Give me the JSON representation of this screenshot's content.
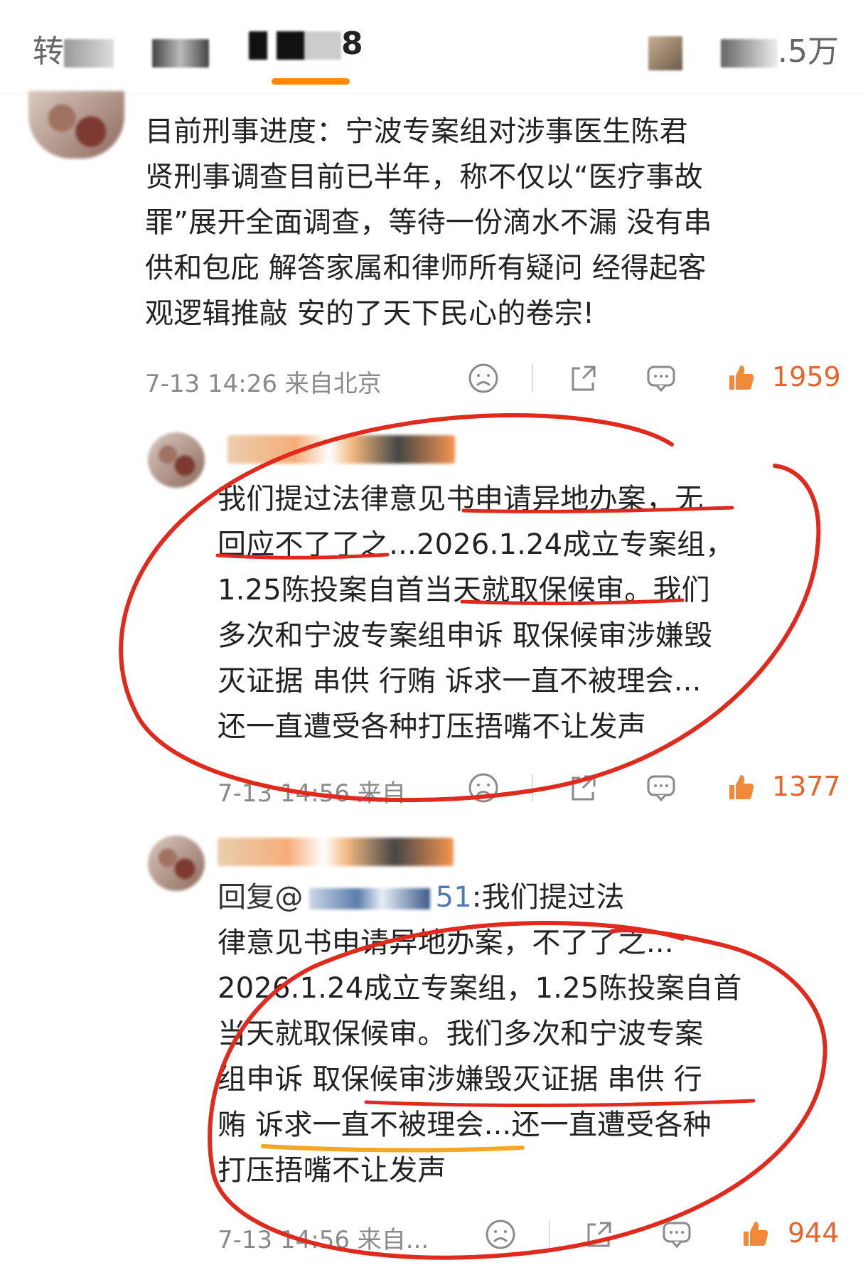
{
  "tabs": {
    "repost": "转",
    "comments": "8",
    "likes": ".5万"
  },
  "comments": [
    {
      "lines": [
        "目前刑事进度：宁波专案组对涉事医生陈君",
        "贤刑事调查目前已半年，称不仅以“医疗事故",
        "罪”展开全面调查，等待一份滴水不漏 没有串",
        "供和包庇 解答家属和律师所有疑问 经得起客",
        "观逻辑推敲 安的了天下民心的卷宗!"
      ],
      "time": "7-13 14:26 来自北京",
      "likes": "1959"
    },
    {
      "lines": [
        "我们提过法律意见书申请异地办案，无",
        "回应不了了之...2026.1.24成立专案组，",
        "1.25陈投案自首当天就取保候审。我们",
        "多次和宁波专案组申诉 取保候审涉嫌毁",
        "灭证据 串供 行贿 诉求一直不被理会...",
        "还一直遭受各种打压捂嘴不让发声"
      ],
      "time": "7-13 14:56 来自...",
      "likes": "1377"
    },
    {
      "reply_prefix": "回复@",
      "mention_suffix": "51",
      "first_line_rest": ":我们提过法",
      "lines": [
        "律意见书申请异地办案，不了了之...",
        "2026.1.24成立专案组，1.25陈投案自首",
        "当天就取保候审。我们多次和宁波专案",
        "组申诉 取保候审涉嫌毁灭证据 串供 行",
        "贿 诉求一直不被理会...还一直遭受各种",
        "打压捂嘴不让发声"
      ],
      "time": "7-13 14:56 来自...",
      "likes": "944"
    }
  ],
  "colors": {
    "like": "#e8642c",
    "annotation_red": "#e02a1e",
    "annotation_orange": "#f5a623",
    "tab_underline": "#ff8a00"
  }
}
